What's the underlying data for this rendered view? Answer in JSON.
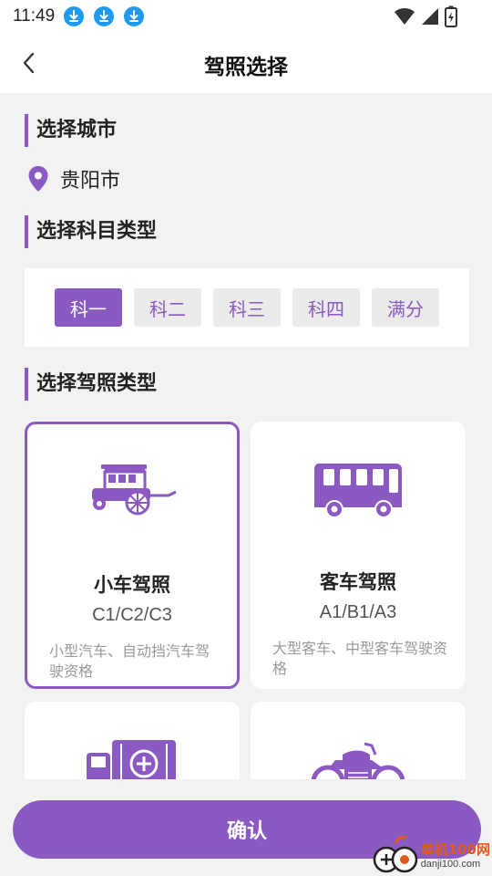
{
  "status_bar": {
    "time": "11:49",
    "notification_icons": [
      "download-icon",
      "download-icon",
      "download-icon"
    ],
    "system_icons": [
      "wifi-icon",
      "signal-icon",
      "battery-charging-icon"
    ]
  },
  "header": {
    "title": "驾照选择",
    "back_icon": "chevron-left-icon"
  },
  "city_section": {
    "title": "选择城市",
    "city": "贵阳市"
  },
  "subject_section": {
    "title": "选择科目类型",
    "options": [
      {
        "label": "科一",
        "selected": true
      },
      {
        "label": "科二",
        "selected": false
      },
      {
        "label": "科三",
        "selected": false
      },
      {
        "label": "科四",
        "selected": false
      },
      {
        "label": "满分",
        "selected": false
      }
    ]
  },
  "license_section": {
    "title": "选择驾照类型",
    "cards": [
      {
        "name": "小车驾照",
        "codes": "C1/C2/C3",
        "desc": "小型汽车、自动挡汽车驾驶资格",
        "icon": "car-icon",
        "selected": true
      },
      {
        "name": "客车驾照",
        "codes": "A1/B1/A3",
        "desc": "大型客车、中型客车驾驶资格",
        "icon": "bus-icon",
        "selected": false
      },
      {
        "name": "",
        "codes": "",
        "desc": "",
        "icon": "truck-icon",
        "selected": false
      },
      {
        "name": "",
        "codes": "",
        "desc": "",
        "icon": "motorcycle-icon",
        "selected": false
      }
    ]
  },
  "footer": {
    "confirm_label": "确认"
  },
  "watermark": {
    "line1": "单机100网",
    "line2": "danji100.com"
  },
  "colors": {
    "accent": "#8a59c2",
    "chip_bg": "#ebebeb",
    "page_bg": "#f2f2f2",
    "download_badge": "#1e9bf0"
  }
}
